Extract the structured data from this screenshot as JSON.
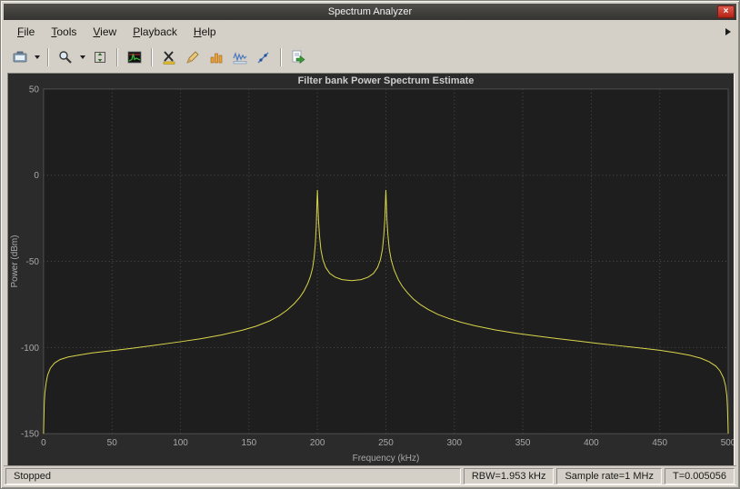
{
  "window": {
    "title": "Spectrum Analyzer",
    "close_label": "×"
  },
  "menu": {
    "items": [
      {
        "label": "File",
        "mnemonic": "F"
      },
      {
        "label": "Tools",
        "mnemonic": "T"
      },
      {
        "label": "View",
        "mnemonic": "V"
      },
      {
        "label": "Playback",
        "mnemonic": "P"
      },
      {
        "label": "Help",
        "mnemonic": "H"
      }
    ]
  },
  "toolbar": {
    "items": [
      {
        "type": "button",
        "name": "snapshot-button",
        "icon": "snapshot-icon"
      },
      {
        "type": "dropdown",
        "name": "snapshot-dropdown"
      },
      {
        "type": "separator"
      },
      {
        "type": "button",
        "name": "zoom-button",
        "icon": "zoom-icon"
      },
      {
        "type": "dropdown",
        "name": "zoom-dropdown"
      },
      {
        "type": "button",
        "name": "fit-to-view-button",
        "icon": "fit-to-view-icon"
      },
      {
        "type": "separator"
      },
      {
        "type": "button",
        "name": "spectrum-settings-button",
        "icon": "spectrum-settings-icon"
      },
      {
        "type": "separator"
      },
      {
        "type": "button",
        "name": "cursor-measurements-button",
        "icon": "cursor-measurements-icon"
      },
      {
        "type": "button",
        "name": "peak-finder-button",
        "icon": "peak-finder-icon"
      },
      {
        "type": "button",
        "name": "channel-measurements-button",
        "icon": "channel-measurements-icon"
      },
      {
        "type": "button",
        "name": "distortion-measurements-button",
        "icon": "distortion-measurements-icon"
      },
      {
        "type": "button",
        "name": "ccdf-measurements-button",
        "icon": "ccdf-measurements-icon"
      },
      {
        "type": "separator"
      },
      {
        "type": "button",
        "name": "playback-settings-button",
        "icon": "playback-settings-icon"
      }
    ]
  },
  "statusbar": {
    "state": "Stopped",
    "rbw": "RBW=1.953 kHz",
    "sample_rate": "Sample rate=1 MHz",
    "time": "T=0.005056"
  },
  "chart_data": {
    "type": "line",
    "title": "Filter bank Power Spectrum Estimate",
    "xlabel": "Frequency (kHz)",
    "ylabel": "Power (dBm)",
    "xlim": [
      0,
      500
    ],
    "ylim": [
      -150,
      50
    ],
    "xticks": [
      0,
      50,
      100,
      150,
      200,
      250,
      300,
      350,
      400,
      450,
      500
    ],
    "yticks": [
      50,
      0,
      -50,
      -100,
      -150
    ],
    "grid": true,
    "legend": "none",
    "colors": {
      "panel_bg": "#2b2b2b",
      "plot_bg": "#1e1e1e",
      "grid": "#4d4d4d",
      "tick": "#a8a8a8",
      "title": "#cccccc",
      "line": "#d9d64a"
    },
    "series": [
      {
        "name": "Filter bank power spectrum estimate",
        "points": [
          [
            0,
            -150
          ],
          [
            0.5,
            -132
          ],
          [
            1,
            -126
          ],
          [
            2,
            -120
          ],
          [
            3,
            -116
          ],
          [
            5,
            -112
          ],
          [
            8,
            -109
          ],
          [
            12,
            -107
          ],
          [
            18,
            -105.5
          ],
          [
            25,
            -104.5
          ],
          [
            35,
            -103.2
          ],
          [
            50,
            -101.8
          ],
          [
            65,
            -100.4
          ],
          [
            80,
            -98.8
          ],
          [
            100,
            -96.6
          ],
          [
            115,
            -94.9
          ],
          [
            130,
            -92.7
          ],
          [
            145,
            -90
          ],
          [
            155,
            -87.7
          ],
          [
            165,
            -84.6
          ],
          [
            172,
            -81.6
          ],
          [
            178,
            -78.2
          ],
          [
            183,
            -74.6
          ],
          [
            187,
            -71
          ],
          [
            190,
            -67.5
          ],
          [
            193,
            -62.8
          ],
          [
            195,
            -58.5
          ],
          [
            196.5,
            -53.8
          ],
          [
            197.5,
            -48.5
          ],
          [
            198.5,
            -40
          ],
          [
            199.2,
            -29
          ],
          [
            199.7,
            -16
          ],
          [
            200,
            -8.6
          ],
          [
            200.3,
            -16
          ],
          [
            200.8,
            -26
          ],
          [
            201.5,
            -35
          ],
          [
            202.5,
            -43
          ],
          [
            204,
            -49
          ],
          [
            206,
            -53.5
          ],
          [
            209,
            -57
          ],
          [
            213,
            -59.2
          ],
          [
            218,
            -60.6
          ],
          [
            225,
            -61.2
          ],
          [
            232,
            -60.6
          ],
          [
            237,
            -59.2
          ],
          [
            241,
            -57
          ],
          [
            244,
            -53.5
          ],
          [
            246,
            -49
          ],
          [
            247.5,
            -43
          ],
          [
            248.5,
            -35
          ],
          [
            249.2,
            -26
          ],
          [
            249.7,
            -16
          ],
          [
            250,
            -8.6
          ],
          [
            250.3,
            -16
          ],
          [
            250.8,
            -26
          ],
          [
            251.5,
            -35
          ],
          [
            252.5,
            -43
          ],
          [
            254,
            -49.5
          ],
          [
            256,
            -55
          ],
          [
            259,
            -60.5
          ],
          [
            262,
            -64.5
          ],
          [
            266,
            -68.5
          ],
          [
            270,
            -71.8
          ],
          [
            275,
            -75
          ],
          [
            281,
            -78
          ],
          [
            288,
            -80.8
          ],
          [
            296,
            -83.2
          ],
          [
            305,
            -85.4
          ],
          [
            315,
            -87.4
          ],
          [
            330,
            -89.8
          ],
          [
            345,
            -91.7
          ],
          [
            360,
            -93.3
          ],
          [
            375,
            -94.8
          ],
          [
            390,
            -96.2
          ],
          [
            405,
            -97.6
          ],
          [
            420,
            -98.9
          ],
          [
            435,
            -100.2
          ],
          [
            450,
            -101.6
          ],
          [
            462,
            -103
          ],
          [
            472,
            -104.5
          ],
          [
            480,
            -106.2
          ],
          [
            486,
            -108.2
          ],
          [
            491,
            -110.8
          ],
          [
            494,
            -113.5
          ],
          [
            496.5,
            -117.5
          ],
          [
            498,
            -122
          ],
          [
            499,
            -128
          ],
          [
            499.5,
            -135
          ],
          [
            500,
            -150
          ]
        ]
      }
    ]
  }
}
